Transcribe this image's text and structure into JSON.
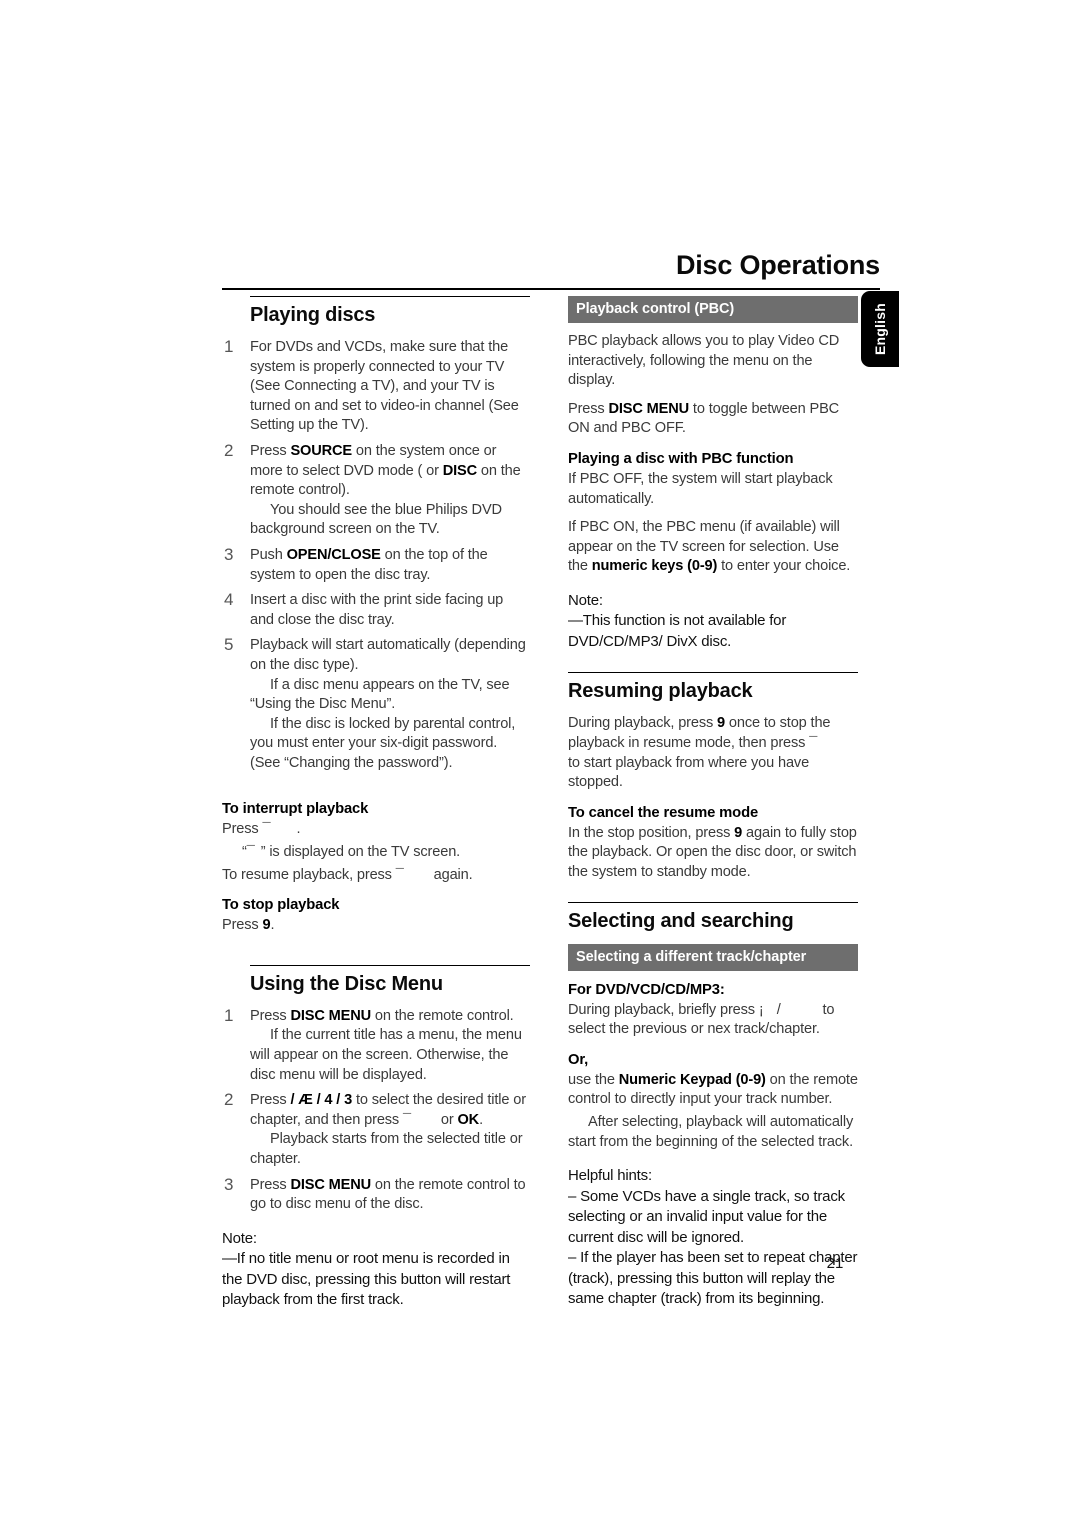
{
  "page": {
    "title": "Disc Operations",
    "language_tab": "English",
    "page_number": "21"
  },
  "left_column": {
    "playing_discs": {
      "heading": "Playing discs",
      "steps": [
        {
          "number": "1",
          "text": "For DVDs and VCDs, make sure that the system is properly connected to your TV (See Connecting a TV), and your TV is turned on and set to video-in channel (See Setting up the TV)."
        },
        {
          "number": "2",
          "text_pre": "Press ",
          "bold_1": "SOURCE",
          "text_mid": " on the system once or more to select DVD mode ( or ",
          "bold_2": "DISC",
          "text_post": " on the remote control).",
          "sub": "You should see the blue Philips DVD background screen on the TV."
        },
        {
          "number": "3",
          "text_pre": "Push ",
          "bold_1": "OPEN/CLOSE",
          "text_post": " on the top of the system to open the disc tray."
        },
        {
          "number": "4",
          "text": "Insert a disc with the print side facing up and close the disc tray."
        },
        {
          "number": "5",
          "text": "Playback will start automatically (depending on the disc type).",
          "sub_1": "If a disc menu appears on the TV, see “Using the Disc Menu”.",
          "sub_2": "If the disc is locked by parental control, you must enter your six-digit password. (See “Changing the password”)."
        }
      ],
      "interrupt": {
        "heading": "To interrupt playback",
        "line_1_pre": "Press ",
        "line_1_symbol": "¯",
        "line_1_post": ".",
        "line_2_pre": "“",
        "line_2_symbol": "¯",
        "line_2_post": "” is displayed on the TV screen.",
        "line_3_pre": "To resume playback, press ",
        "line_3_symbol": "¯",
        "line_3_post": " again."
      },
      "stop": {
        "heading": "To stop playback",
        "line_pre": "Press ",
        "line_symbol": "9",
        "line_post": "."
      }
    },
    "disc_menu": {
      "heading": "Using the Disc Menu",
      "steps": [
        {
          "number": "1",
          "text_pre": "Press ",
          "bold_1": "DISC MENU",
          "text_post": " on the remote control.",
          "sub": "If the current title has a menu, the menu will appear on the screen.  Otherwise, the disc menu will be displayed."
        },
        {
          "number": "2",
          "text_pre": "Press ",
          "symbols": " / Æ / 4 / 3 ",
          "text_mid": "to select the desired title or chapter, and then press ",
          "symbol_2": "¯",
          "text_mid_2": " or ",
          "bold_2": "OK",
          "text_post": ".",
          "sub": "Playback starts from the selected title or chapter."
        },
        {
          "number": "3",
          "text_pre": "Press ",
          "bold_1": "DISC MENU",
          "text_post": " on the remote control to go to disc menu of the disc."
        }
      ],
      "note": {
        "label": "Note:",
        "body": "—If no title menu or root menu is recorded in the DVD disc, pressing this button will restart playback from the first track."
      }
    }
  },
  "right_column": {
    "pbc": {
      "bar_label": "Playback  control (PBC)",
      "para_1": "PBC playback allows you to play Video CD interactively, following the menu on the display.",
      "para_2_pre": "Press ",
      "para_2_bold": "DISC MENU",
      "para_2_post": " to toggle between PBC ON and PBC OFF.",
      "sub_heading": "Playing a disc with PBC function",
      "para_3": "If PBC OFF, the system will start playback automatically.",
      "para_4_pre": "If PBC ON, the PBC menu (if available) will appear on the TV screen for selection. Use the ",
      "para_4_bold": "numeric keys (0-9)",
      "para_4_post": " to enter your choice.",
      "note": {
        "label": "Note:",
        "body": "—This function is not available for DVD/CD/MP3/ DivX disc."
      }
    },
    "resuming": {
      "heading": "Resuming playback",
      "para_pre": "During playback, press ",
      "para_sym_1": "9",
      "para_mid": " once to stop the playback in resume mode, then press ",
      "para_sym_2": "¯",
      "para_post": " to start playback from where you have stopped.",
      "cancel_heading": "To cancel the resume mode",
      "cancel_pre": "In the stop position, press ",
      "cancel_sym": "9",
      "cancel_post": " again to fully stop the playback. Or open the disc door, or switch the system to standby mode."
    },
    "selecting": {
      "heading": "Selecting and searching",
      "bar_label": "Selecting a different track/chapter",
      "for_label": "For DVD/VCD/CD/MP3:",
      "for_pre": "During playback, briefly press ",
      "for_sym_1": "¡",
      "for_mid": " / ",
      "for_sym_2": "",
      "for_post": " to select the previous or nex track/chapter.",
      "or_label": "Or,",
      "or_pre": "use the ",
      "or_bold": "Numeric Keypad (0-9)",
      "or_post": " on the remote control to directly input your track number.",
      "or_sub": "After selecting, playback will automatically start from the beginning of the selected track.",
      "hints": {
        "label": "Helpful hints:",
        "item_1": "–  Some VCDs have a single track,  so track selecting or an invalid input value for the current disc will be ignored.",
        "item_2": "–   If the player has been set to repeat chapter (track), pressing this button will replay the same chapter (track) from its beginning."
      }
    }
  }
}
